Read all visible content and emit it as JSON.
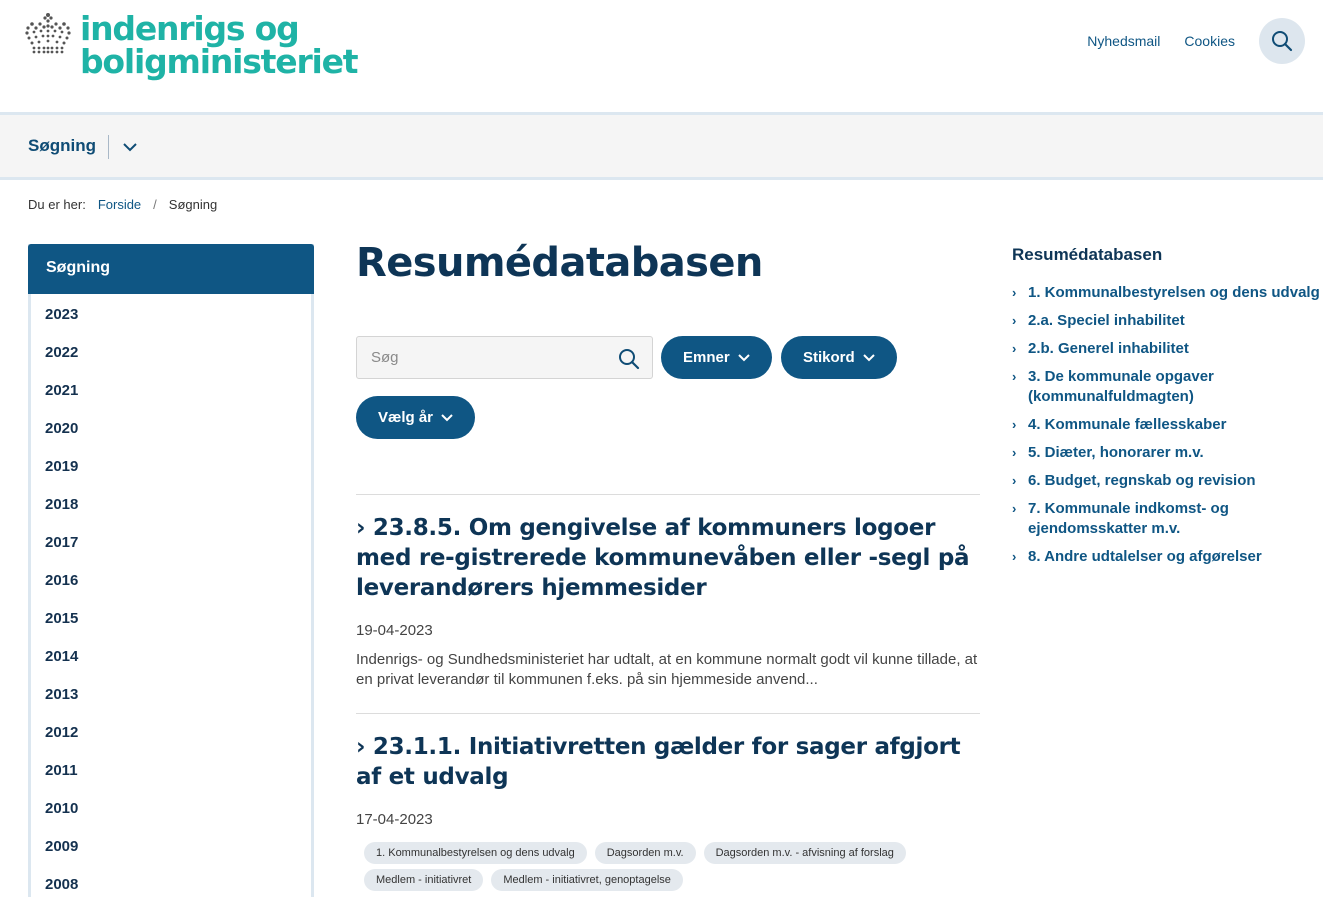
{
  "header": {
    "logo_line1": "indenrigs og",
    "logo_line2": "boligministeriet",
    "links": [
      "Nyhedsmail",
      "Cookies"
    ],
    "search_icon": "search-icon",
    "brand_color": "#1fb3a6"
  },
  "subnav": {
    "label": "Søgning",
    "toggle_icon": "chevron-down-icon"
  },
  "breadcrumb": {
    "prefix": "Du er her:",
    "home": "Forside",
    "separator": "/",
    "current": "Søgning"
  },
  "sidebar": {
    "title": "Søgning",
    "years": [
      "2023",
      "2022",
      "2021",
      "2020",
      "2019",
      "2018",
      "2017",
      "2016",
      "2015",
      "2014",
      "2013",
      "2012",
      "2011",
      "2010",
      "2009",
      "2008"
    ]
  },
  "main": {
    "title": "Resumédatabasen",
    "search_placeholder": "Søg",
    "filters": {
      "emner": "Emner",
      "stikord": "Stikord",
      "year": "Vælg år"
    },
    "results": [
      {
        "title": "› 23.8.5. Om gengivelse af kommuners logoer med re-gistrerede kommunevåben eller -segl på leverandørers hjemmesider",
        "date": "19-04-2023",
        "desc": "Indenrigs- og Sundhedsministeriet har udtalt, at en kommune normalt godt vil kunne tillade, at en privat leverandør til kommunen f.eks. på sin hjemmeside anvend..."
      },
      {
        "title": "› 23.1.1. Initiativretten gælder for sager afgjort af et udvalg",
        "date": "17-04-2023",
        "tags": [
          "1. Kommunalbestyrelsen og dens udvalg",
          "Dagsorden m.v.",
          "Dagsorden m.v. - afvisning af forslag",
          "Medlem - initiativret",
          "Medlem - initiativret, genoptagelse"
        ]
      }
    ]
  },
  "right": {
    "title": "Resumédatabasen",
    "items": [
      "1. Kommunalbestyrelsen og dens udvalg",
      "2.a. Speciel inhabilitet",
      "2.b. Generel inhabilitet",
      "3. De kommunale opgaver (kommunalfuldmagten)",
      "4. Kommunale fællesskaber",
      "5. Diæter, honorarer m.v.",
      "6. Budget, regnskab og revision",
      "7. Kommunale indkomst- og ejendomsskatter m.v.",
      "8. Andre udtalelser og afgørelser"
    ],
    "arrow": "›"
  },
  "colors": {
    "primary": "#0f5684",
    "heading": "#0e3556",
    "accent": "#1fb3a6"
  }
}
